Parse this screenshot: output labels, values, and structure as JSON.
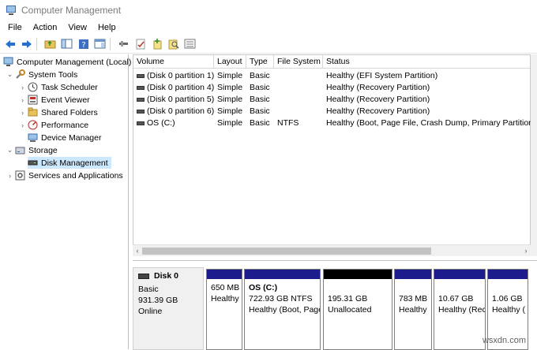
{
  "window": {
    "title": "Computer Management"
  },
  "menu": [
    "File",
    "Action",
    "View",
    "Help"
  ],
  "toolbar": {
    "icons": [
      "back-icon",
      "forward-icon",
      "up-folder-icon",
      "show-hide-tree-icon",
      "help-icon",
      "properties-icon",
      "connect-icon",
      "check-icon",
      "new-icon",
      "search-icon",
      "list-icon"
    ]
  },
  "tree": {
    "root": "Computer Management (Local)",
    "system_tools": "System Tools",
    "task_scheduler": "Task Scheduler",
    "event_viewer": "Event Viewer",
    "shared_folders": "Shared Folders",
    "performance": "Performance",
    "device_manager": "Device Manager",
    "storage": "Storage",
    "disk_management": "Disk Management",
    "services_apps": "Services and Applications"
  },
  "volumes": {
    "columns": [
      "Volume",
      "Layout",
      "Type",
      "File System",
      "Status"
    ],
    "rows": [
      [
        "(Disk 0 partition 1)",
        "Simple",
        "Basic",
        "",
        "Healthy (EFI System Partition)"
      ],
      [
        "(Disk 0 partition 4)",
        "Simple",
        "Basic",
        "",
        "Healthy (Recovery Partition)"
      ],
      [
        "(Disk 0 partition 5)",
        "Simple",
        "Basic",
        "",
        "Healthy (Recovery Partition)"
      ],
      [
        "(Disk 0 partition 6)",
        "Simple",
        "Basic",
        "",
        "Healthy (Recovery Partition)"
      ],
      [
        "OS (C:)",
        "Simple",
        "Basic",
        "NTFS",
        "Healthy (Boot, Page File, Crash Dump, Primary Partition)"
      ]
    ]
  },
  "disk": {
    "name": "Disk 0",
    "type": "Basic",
    "size": "931.39 GB",
    "state": "Online",
    "partitions": [
      {
        "name": "",
        "size": "650 MB",
        "status": "Healthy",
        "unallocated": false
      },
      {
        "name": "OS  (C:)",
        "size": "722.93 GB NTFS",
        "status": "Healthy (Boot, Page",
        "unallocated": false
      },
      {
        "name": "",
        "size": "195.31 GB",
        "status": "Unallocated",
        "unallocated": true
      },
      {
        "name": "",
        "size": "783 MB",
        "status": "Healthy",
        "unallocated": false
      },
      {
        "name": "",
        "size": "10.67 GB",
        "status": "Healthy (Rec",
        "unallocated": false
      },
      {
        "name": "",
        "size": "1.06 GB",
        "status": "Healthy (",
        "unallocated": false
      }
    ]
  },
  "watermark": "wsxdn.com",
  "colors": {
    "partition_bar": "#1c1c8c",
    "unallocated_bar": "#000000",
    "selection": "#cce8ff"
  }
}
